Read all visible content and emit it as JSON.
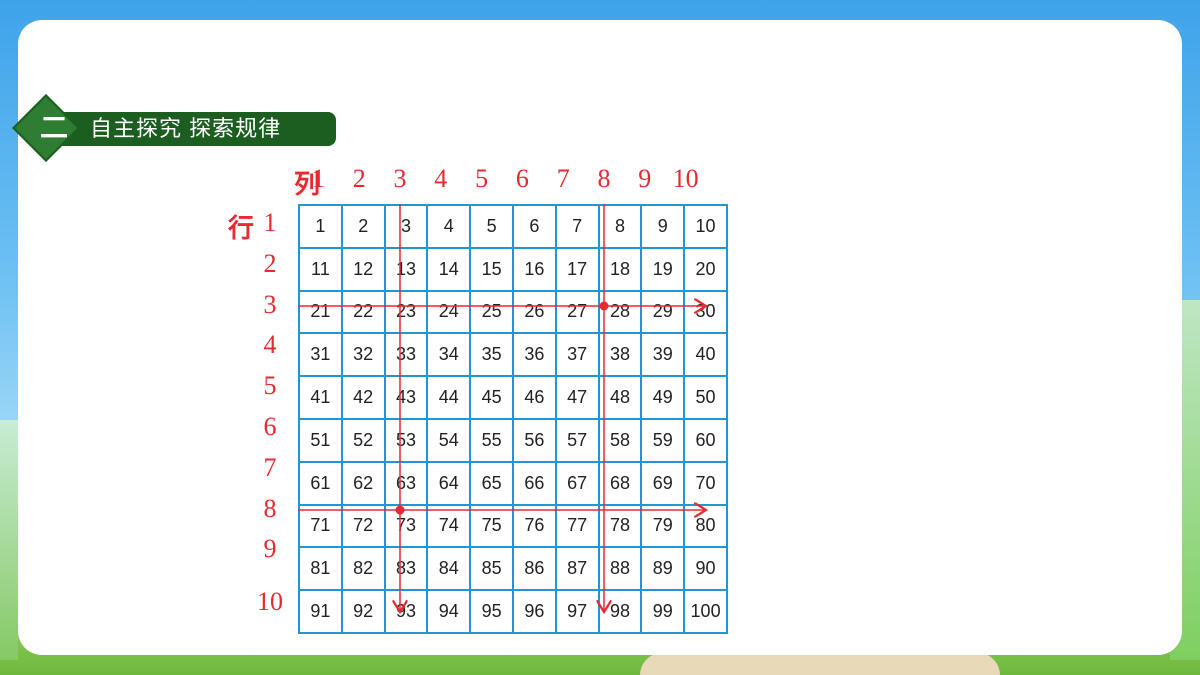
{
  "section": {
    "number": "二",
    "title": "自主探究  探索规律"
  },
  "labels": {
    "column": "列",
    "row": "行"
  },
  "column_numbers": [
    "1",
    "2",
    "3",
    "4",
    "5",
    "6",
    "7",
    "8",
    "9",
    "10"
  ],
  "row_numbers": [
    "1",
    "2",
    "3",
    "4",
    "5",
    "6",
    "7",
    "8",
    "9",
    "10"
  ],
  "table": [
    [
      "1",
      "2",
      "3",
      "4",
      "5",
      "6",
      "7",
      "8",
      "9",
      "10"
    ],
    [
      "11",
      "12",
      "13",
      "14",
      "15",
      "16",
      "17",
      "18",
      "19",
      "20"
    ],
    [
      "21",
      "22",
      "23",
      "24",
      "25",
      "26",
      "27",
      "28",
      "29",
      "30"
    ],
    [
      "31",
      "32",
      "33",
      "34",
      "35",
      "36",
      "37",
      "38",
      "39",
      "40"
    ],
    [
      "41",
      "42",
      "43",
      "44",
      "45",
      "46",
      "47",
      "48",
      "49",
      "50"
    ],
    [
      "51",
      "52",
      "53",
      "54",
      "55",
      "56",
      "57",
      "58",
      "59",
      "60"
    ],
    [
      "61",
      "62",
      "63",
      "64",
      "65",
      "66",
      "67",
      "68",
      "69",
      "70"
    ],
    [
      "71",
      "72",
      "73",
      "74",
      "75",
      "76",
      "77",
      "78",
      "79",
      "80"
    ],
    [
      "81",
      "82",
      "83",
      "84",
      "85",
      "86",
      "87",
      "88",
      "89",
      "90"
    ],
    [
      "91",
      "92",
      "93",
      "94",
      "95",
      "96",
      "97",
      "98",
      "99",
      "100"
    ]
  ],
  "annotations": {
    "highlighted_rows": [
      3,
      8
    ],
    "highlighted_columns": [
      3,
      8
    ],
    "marked_numbers": [
      "28",
      "73"
    ],
    "line_color": "#e8292f"
  },
  "colors": {
    "grid_border": "#2196d6",
    "banner": "#1b5e20",
    "label_red": "#e8292f"
  }
}
